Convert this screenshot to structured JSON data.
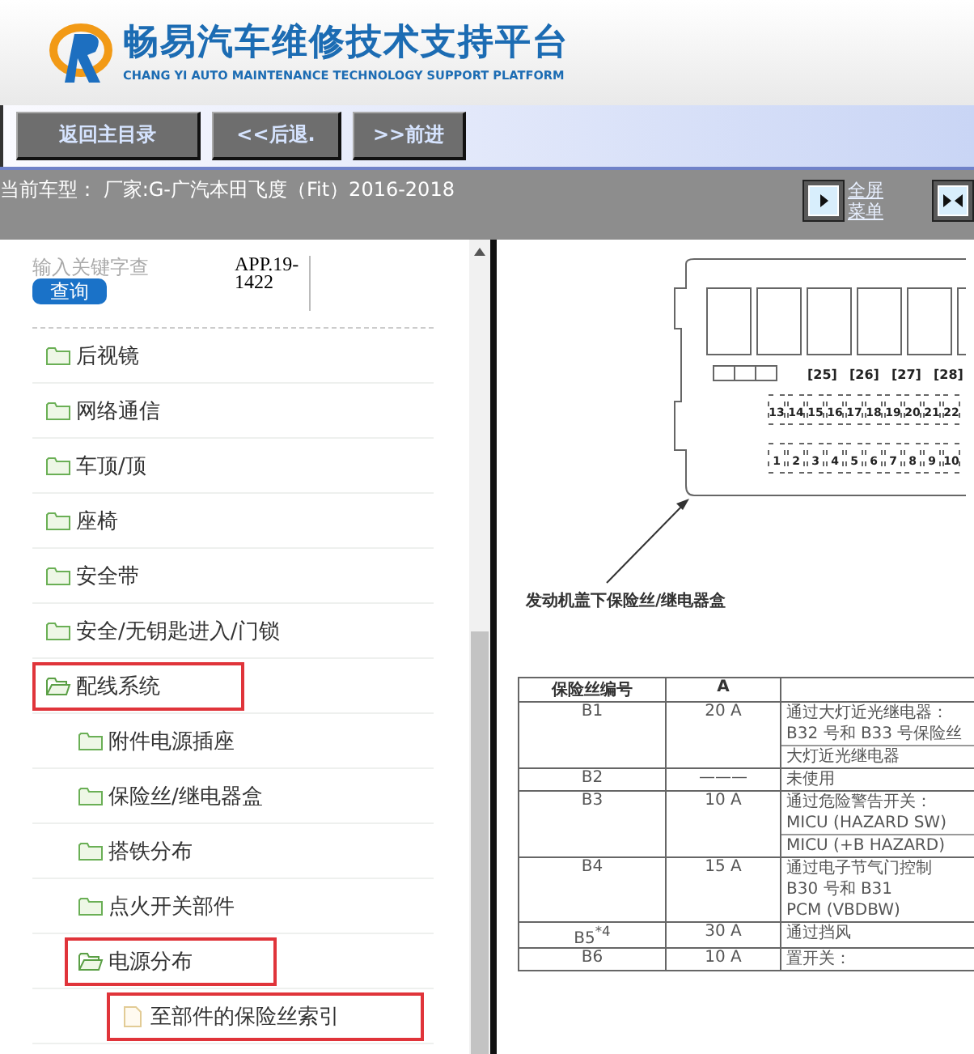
{
  "header": {
    "title": "畅易汽车维修技术支持平台",
    "subtitle": "CHANG YI AUTO MAINTENANCE TECHNOLOGY SUPPORT PLATFORM"
  },
  "nav_buttons": [
    "返回主目录",
    "<<后退.",
    ">>前进"
  ],
  "vehicle_info": "当前车型： 厂家:G-广汽本田飞度（Fit）2016-2018",
  "view_buttons": [
    {
      "kind": "fullscreen",
      "label": [
        "全屏",
        "菜单"
      ]
    },
    {
      "kind": "default"
    }
  ],
  "search": {
    "placeholder": "输入关键字查",
    "button": "查询",
    "code": "APP.19-1422"
  },
  "tree": [
    {
      "label": "后视镜",
      "kind": "folder",
      "expanded": false,
      "highlighted": false
    },
    {
      "label": "网络通信",
      "kind": "folder",
      "expanded": false,
      "highlighted": false
    },
    {
      "label": "车顶/顶",
      "kind": "folder",
      "expanded": false,
      "highlighted": false
    },
    {
      "label": "座椅",
      "kind": "folder",
      "expanded": false,
      "highlighted": false
    },
    {
      "label": "安全带",
      "kind": "folder",
      "expanded": false,
      "highlighted": false
    },
    {
      "label": "安全/无钥匙进入/门锁",
      "kind": "folder",
      "expanded": false,
      "highlighted": false
    },
    {
      "label": "配线系统",
      "kind": "folder",
      "expanded": true,
      "highlighted": true,
      "children": [
        {
          "label": "附件电源插座",
          "kind": "folder",
          "expanded": false,
          "highlighted": false
        },
        {
          "label": "保险丝/继电器盒",
          "kind": "folder",
          "expanded": false,
          "highlighted": false
        },
        {
          "label": "搭铁分布",
          "kind": "folder",
          "expanded": false,
          "highlighted": false
        },
        {
          "label": "点火开关部件",
          "kind": "folder",
          "expanded": false,
          "highlighted": false
        },
        {
          "label": "电源分布",
          "kind": "folder",
          "expanded": true,
          "highlighted": true,
          "children": [
            {
              "label": "至部件的保险丝索引",
              "kind": "document",
              "highlighted": true
            }
          ]
        }
      ]
    }
  ],
  "document": {
    "fuse_box": {
      "slot_labels": [
        "[25]",
        "[26]",
        "[27]",
        "[28]"
      ],
      "upper_numbers": [
        "13",
        "14",
        "15",
        "16",
        "17",
        "18",
        "19",
        "20",
        "21",
        "22"
      ],
      "lower_numbers": [
        "1",
        "2",
        "3",
        "4",
        "5",
        "6",
        "7",
        "8",
        "9",
        "10"
      ]
    },
    "caption": "发动机盖下保险丝/继电器盒",
    "table": {
      "columns": [
        "保险丝编号",
        "A"
      ],
      "rows": [
        {
          "fuse": "B1",
          "amps": "20 A",
          "circuits": [
            [
              "通过大灯近光继电器：",
              "B32 号和 B33 号保险丝"
            ],
            [
              "大灯近光继电器"
            ]
          ]
        },
        {
          "fuse": "B2",
          "amps": "———",
          "circuits": [
            [
              "未使用"
            ]
          ]
        },
        {
          "fuse": "B3",
          "amps": "10 A",
          "circuits": [
            [
              "通过危险警告开关：",
              "MICU (HAZARD SW)"
            ],
            [
              "MICU (+B HAZARD)"
            ]
          ]
        },
        {
          "fuse": "B4",
          "amps": "15 A",
          "circuits": [
            [
              "通过电子节气门控制",
              "B30 号和 B31",
              "PCM (VBDBW)"
            ]
          ]
        },
        {
          "fuse": "B5$^{*4}$",
          "amps": "30 A",
          "circuits": [
            [
              "通过挡风"
            ]
          ]
        },
        {
          "fuse": "B6",
          "amps": "10 A",
          "circuits": [
            [
              "置开关："
            ]
          ]
        }
      ]
    }
  }
}
